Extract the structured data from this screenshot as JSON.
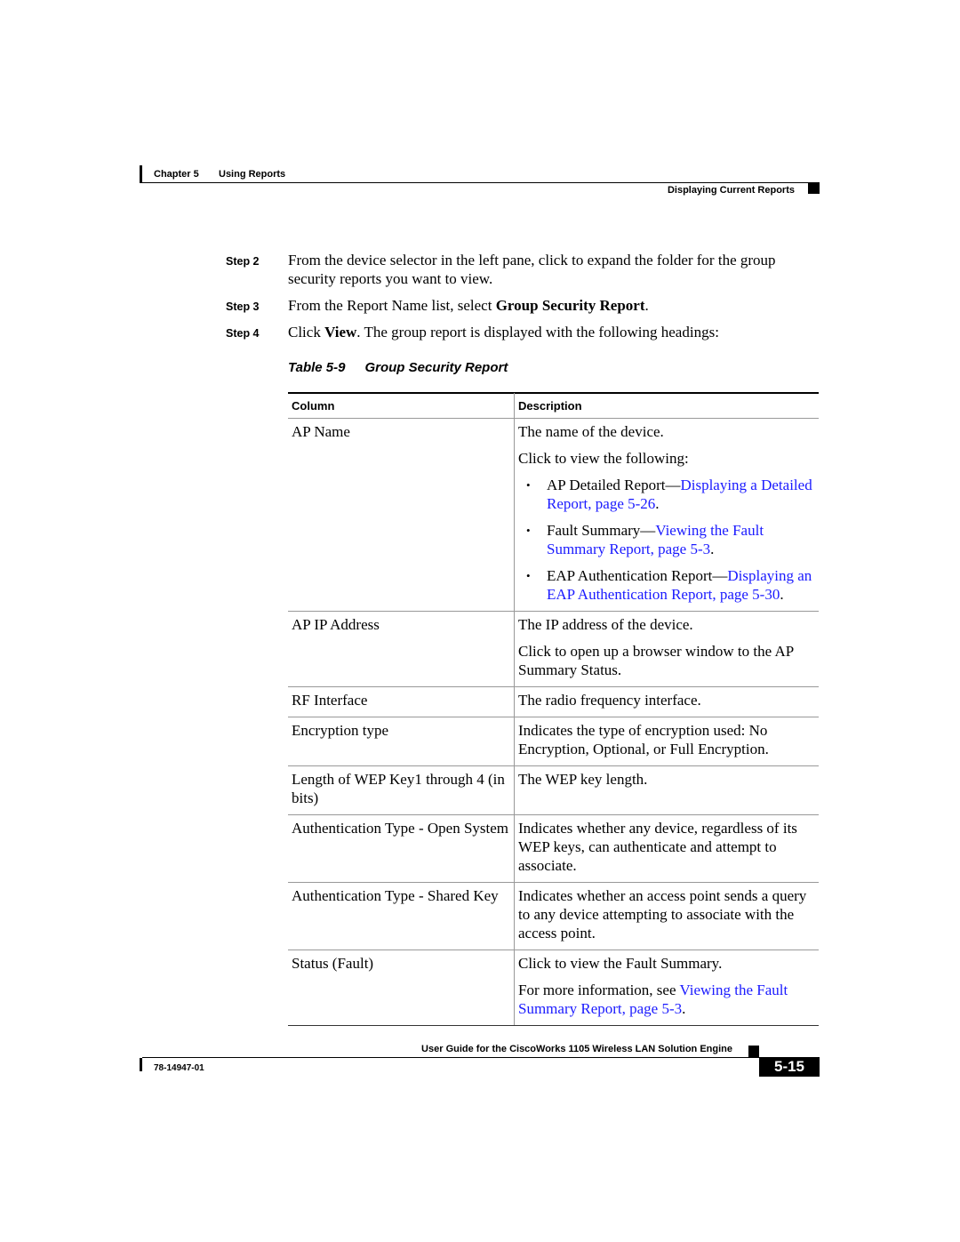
{
  "header": {
    "chapter": "Chapter 5",
    "chapter_title": "Using Reports",
    "section": "Displaying Current Reports"
  },
  "steps": [
    {
      "label": "Step 2",
      "text": "From the device selector in the left pane, click to expand the folder for the group security reports you want to view."
    },
    {
      "label": "Step 3",
      "text_pre": "From the Report Name list, select ",
      "text_bold": "Group Security Report",
      "text_post": "."
    },
    {
      "label": "Step 4",
      "text_pre": "Click ",
      "text_bold": "View",
      "text_post": ". The group report is displayed with the following headings:"
    }
  ],
  "table": {
    "caption_number": "Table 5-9",
    "caption_title": "Group Security Report",
    "headers": [
      "Column",
      "Description"
    ],
    "rows": [
      {
        "column": "AP Name",
        "desc": [
          "The name of the device.",
          "Click to view the following:"
        ],
        "bullets": [
          {
            "text": "AP Detailed Report—",
            "link": "Displaying a Detailed Report, page 5-26",
            "post": "."
          },
          {
            "text": "Fault Summary—",
            "link": "Viewing the Fault Summary Report, page 5-3",
            "post": "."
          },
          {
            "text": "EAP Authentication Report—",
            "link": "Displaying an EAP Authentication Report, page 5-30",
            "post": "."
          }
        ]
      },
      {
        "column": "AP IP Address",
        "desc": [
          "The IP address of the device.",
          "Click to open up a browser window to the AP Summary Status."
        ]
      },
      {
        "column": "RF Interface",
        "desc": [
          "The radio frequency interface."
        ]
      },
      {
        "column": "Encryption type",
        "desc": [
          "Indicates the type of encryption used: No Encryption, Optional, or Full Encryption."
        ]
      },
      {
        "column": "Length of WEP Key1 through 4 (in bits)",
        "desc": [
          "The WEP key length."
        ]
      },
      {
        "column": "Authentication Type - Open System",
        "desc": [
          "Indicates whether any device, regardless of its WEP keys, can authenticate and attempt to associate."
        ]
      },
      {
        "column": "Authentication Type - Shared Key",
        "desc": [
          "Indicates whether an access point sends a query to any device attempting to associate with the access point."
        ]
      },
      {
        "column": "Status (Fault)",
        "desc": [
          "Click to view the Fault Summary."
        ],
        "more_pre": "For more information, see ",
        "more_link": "Viewing the Fault Summary Report, page 5-3",
        "more_post": "."
      }
    ]
  },
  "footer": {
    "guide_title": "User Guide for the CiscoWorks 1105 Wireless LAN Solution Engine",
    "doc_number": "78-14947-01",
    "page_number": "5-15"
  },
  "colors": {
    "link": "#1a1aff",
    "text": "#000000"
  }
}
